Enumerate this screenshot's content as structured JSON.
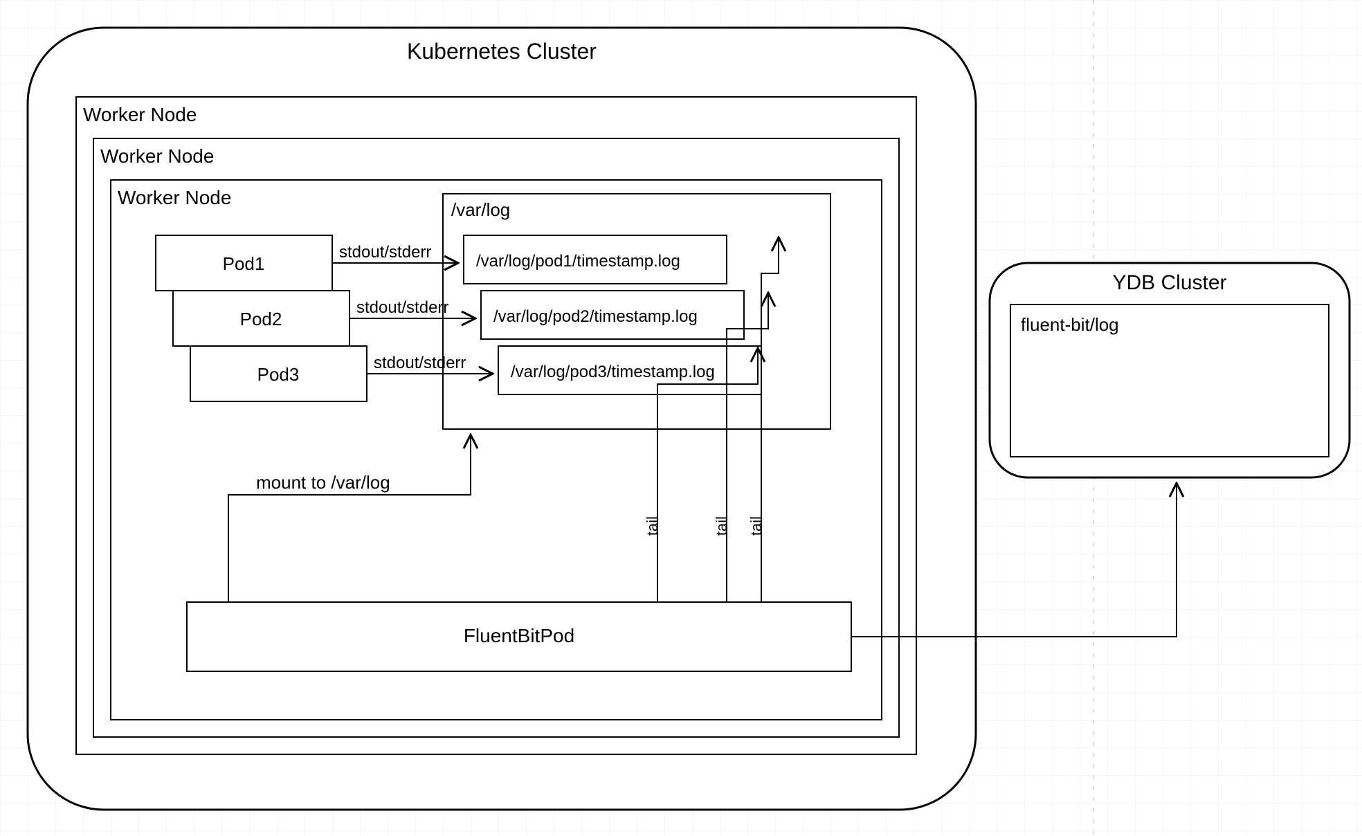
{
  "k8s": {
    "title": "Kubernetes Cluster"
  },
  "workerNodes": {
    "outer": "Worker Node",
    "mid": "Worker Node",
    "inner": "Worker Node"
  },
  "pods": {
    "p1": "Pod1",
    "p2": "Pod2",
    "p3": "Pod3"
  },
  "stdio": {
    "s1": "stdout/stderr",
    "s2": "stdout/stderr",
    "s3": "stdout/stderr"
  },
  "varlog": {
    "title": "/var/log",
    "f1": "/var/log/pod1/timestamp.log",
    "f2": "/var/log/pod2/timestamp.log",
    "f3": "/var/log/pod3/timestamp.log"
  },
  "fluentBit": {
    "label": "FluentBitPod"
  },
  "mountLabel": "mount to /var/log",
  "tail": {
    "t1": "tail",
    "t2": "tail",
    "t3": "tail"
  },
  "ydb": {
    "title": "YDB Cluster",
    "box": "fluent-bit/log"
  }
}
